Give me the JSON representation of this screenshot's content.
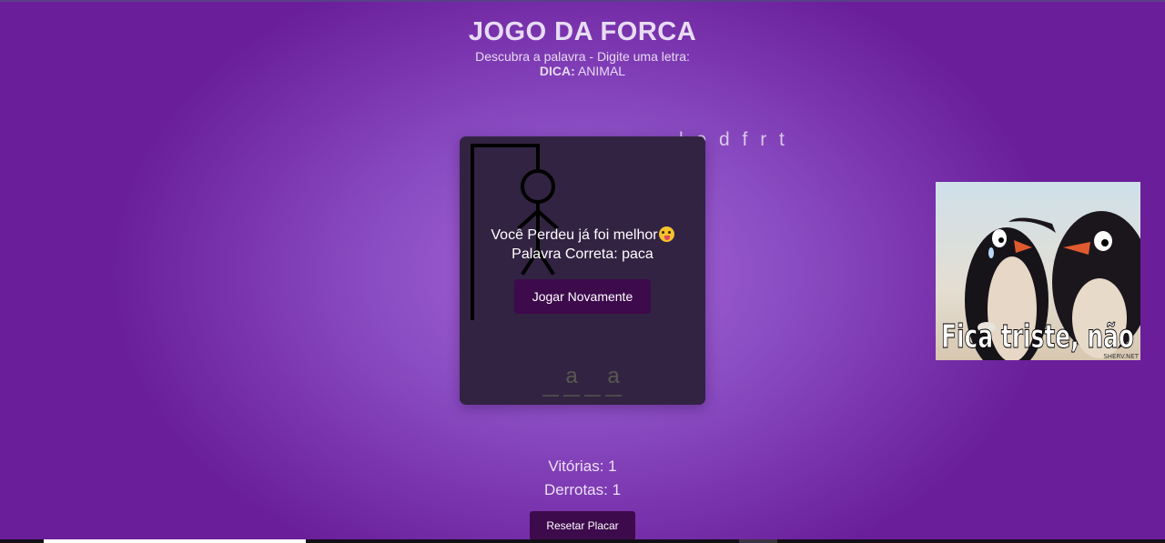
{
  "header": {
    "title": "JOGO DA FORCA",
    "subtitle": "Descubra a palavra - Digite uma letra:",
    "hint_label": "DICA:",
    "hint_value": "ANIMAL"
  },
  "wrong_letters": "l e d f r t",
  "game": {
    "result_message": "Você Perdeu já foi melhor",
    "emoji": "face-with-tongue-icon",
    "correct_word_text": "Palavra Correta: paca",
    "play_again_label": "Jogar Novamente",
    "word_slots": [
      "",
      "a",
      "",
      "a"
    ]
  },
  "meme": {
    "caption": "Fica triste, não",
    "watermark": "SHERV.NET"
  },
  "score": {
    "wins_text": "Vitórias: 1",
    "losses_text": "Derrotas: 1",
    "reset_label": "Resetar Placar"
  },
  "colors": {
    "background": "#8a4cc2",
    "card": "#322342",
    "button": "#3d0a4c"
  }
}
